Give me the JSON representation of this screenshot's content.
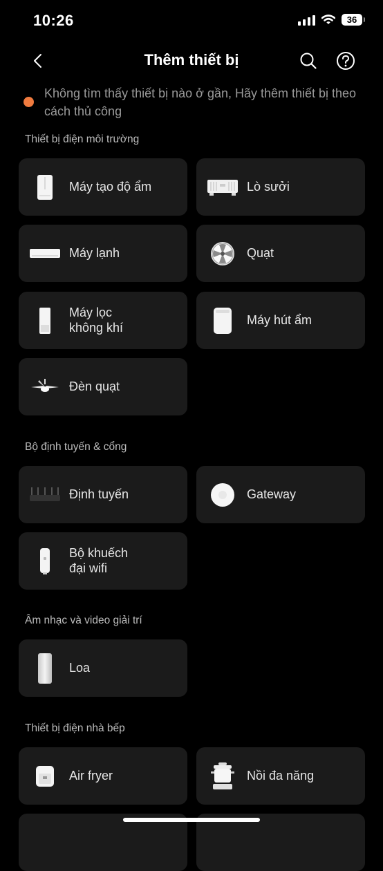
{
  "status": {
    "time": "10:26",
    "battery": "36"
  },
  "header": {
    "title": "Thêm thiết bị"
  },
  "notice": {
    "text": "Không tìm thấy thiết bị nào ở gần, Hãy thêm thiết bị theo cách thủ công",
    "dot_color": "#f07b3f"
  },
  "sections": {
    "environment": {
      "title": "Thiết bị điện môi trường",
      "items": [
        "Máy tạo độ ẩm",
        "Lò sưởi",
        "Máy lạnh",
        "Quạt",
        "Máy lọc\nkhông khí",
        "Máy hút ẩm",
        "Đèn quạt"
      ]
    },
    "router": {
      "title": "Bộ định tuyến & cổng",
      "items": [
        "Định tuyến",
        "Gateway",
        "Bộ khuếch\nđại wifi"
      ]
    },
    "entertainment": {
      "title": "Âm nhạc và video giải trí",
      "items": [
        "Loa"
      ]
    },
    "kitchen": {
      "title": "Thiết bị điện nhà bếp",
      "items": [
        "Air fryer",
        "Nồi đa năng"
      ]
    }
  }
}
